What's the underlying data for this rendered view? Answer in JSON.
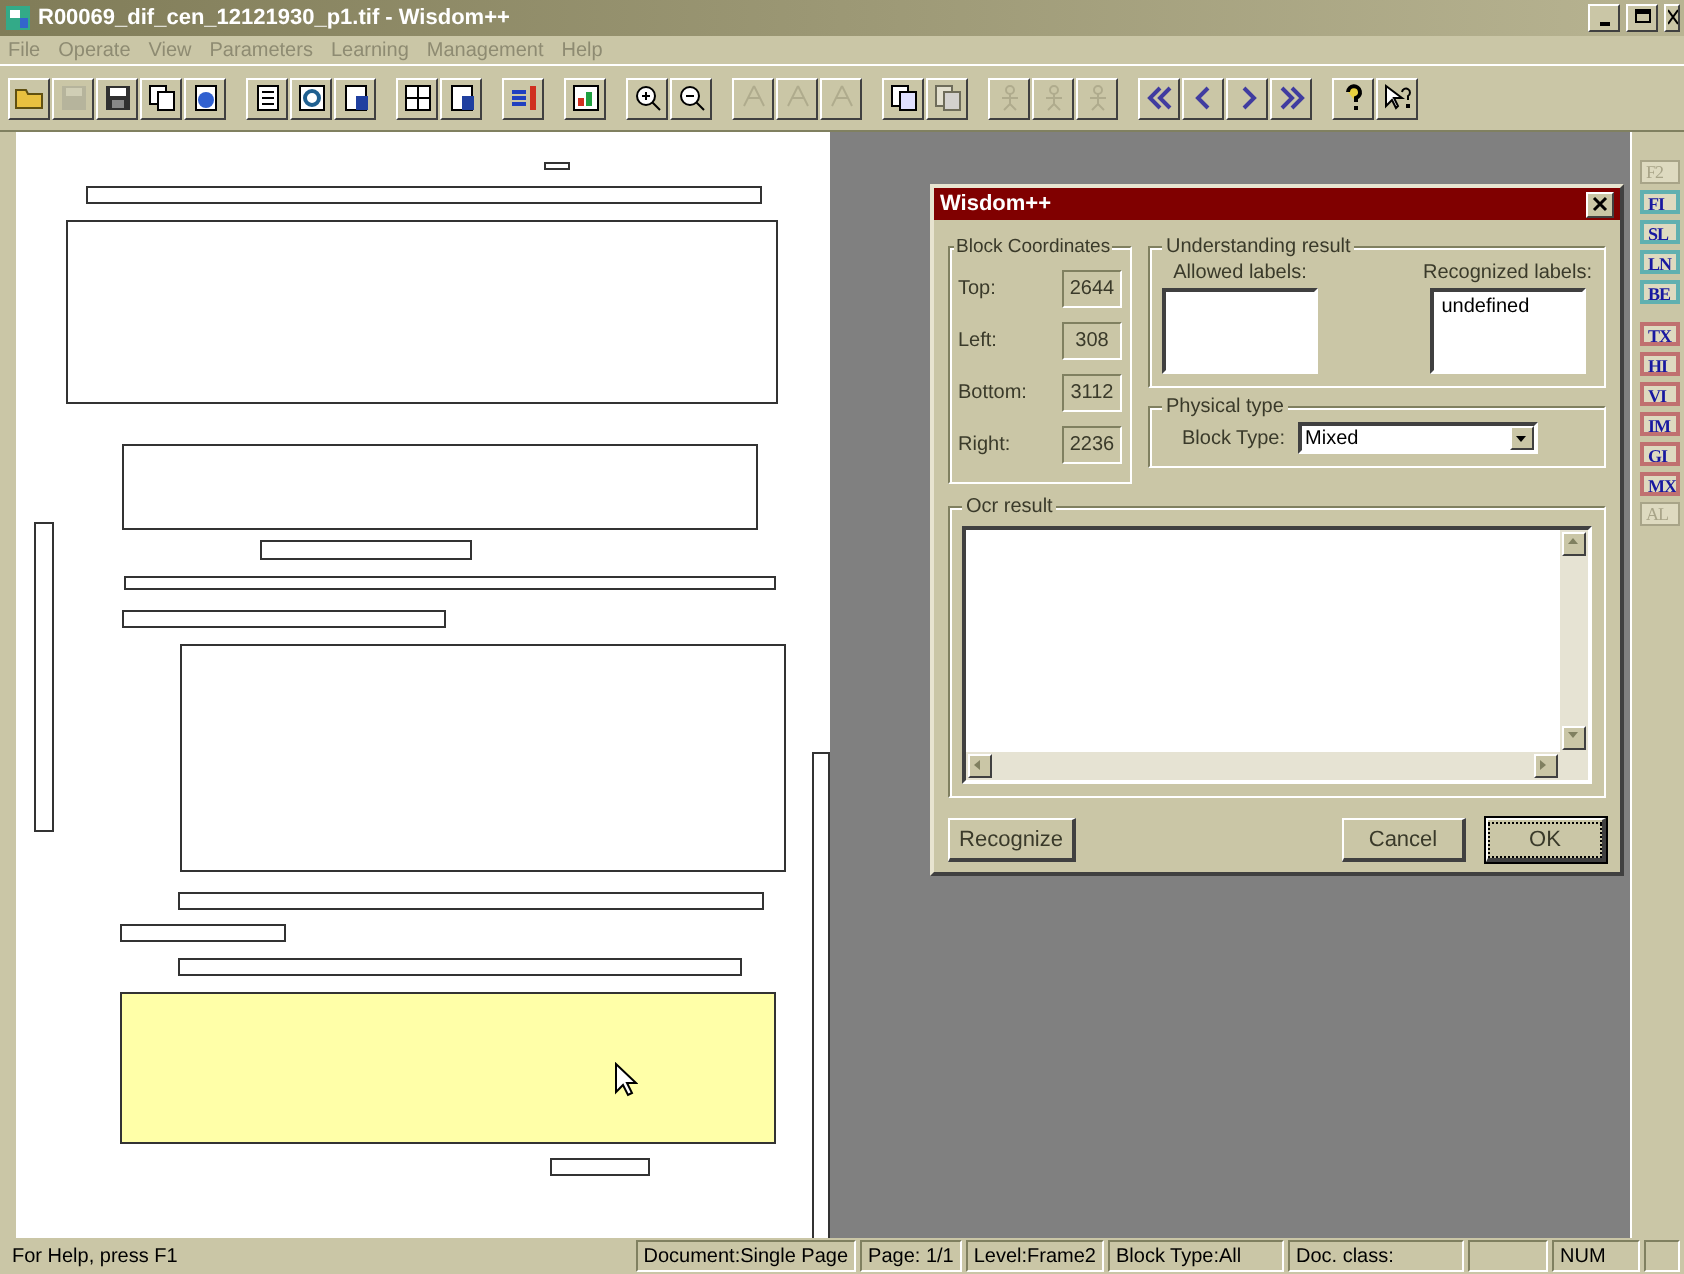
{
  "window": {
    "title": "R00069_dif_cen_12121930_p1.tif - Wisdom++"
  },
  "menu": [
    {
      "label": "File",
      "disabled": true
    },
    {
      "label": "Operate",
      "disabled": true
    },
    {
      "label": "View",
      "disabled": true
    },
    {
      "label": "Parameters",
      "disabled": true
    },
    {
      "label": "Learning",
      "disabled": true
    },
    {
      "label": "Management",
      "disabled": true
    },
    {
      "label": "Help",
      "disabled": true
    }
  ],
  "toolbar": [
    [
      {
        "kind": "open",
        "disabled": false
      },
      {
        "kind": "save",
        "disabled": true
      },
      {
        "kind": "disk",
        "disabled": false
      },
      {
        "kind": "copy",
        "disabled": false
      },
      {
        "kind": "globe",
        "disabled": false
      }
    ],
    [
      {
        "kind": "doc",
        "disabled": false
      },
      {
        "kind": "refresh",
        "disabled": false
      },
      {
        "kind": "docq",
        "disabled": false
      }
    ],
    [
      {
        "kind": "grid",
        "disabled": false
      },
      {
        "kind": "docq",
        "disabled": false
      }
    ],
    [
      {
        "kind": "pencil",
        "disabled": false
      }
    ],
    [
      {
        "kind": "chart",
        "disabled": false
      }
    ],
    [
      {
        "kind": "zoomin",
        "disabled": false
      },
      {
        "kind": "zoomout",
        "disabled": false
      }
    ],
    [
      {
        "kind": "tree",
        "disabled": true
      },
      {
        "kind": "tree",
        "disabled": true
      },
      {
        "kind": "tree",
        "disabled": true
      }
    ],
    [
      {
        "kind": "pages",
        "disabled": false
      },
      {
        "kind": "pages",
        "disabled": true
      }
    ],
    [
      {
        "kind": "figure",
        "disabled": true
      },
      {
        "kind": "figure",
        "disabled": true
      },
      {
        "kind": "figure",
        "disabled": true
      }
    ],
    [
      {
        "kind": "first",
        "disabled": false
      },
      {
        "kind": "prev",
        "disabled": false
      },
      {
        "kind": "next",
        "disabled": false
      },
      {
        "kind": "last",
        "disabled": false
      }
    ],
    [
      {
        "kind": "help",
        "disabled": false
      },
      {
        "kind": "contexthelp",
        "disabled": false
      }
    ]
  ],
  "document": {
    "blocks": [
      {
        "kind": "rect",
        "selected": false
      },
      {
        "kind": "rect",
        "selected": false
      },
      {
        "kind": "rect",
        "selected": false
      },
      {
        "kind": "rect",
        "selected": false
      },
      {
        "kind": "rect",
        "selected": false
      },
      {
        "kind": "rect",
        "selected": false
      },
      {
        "kind": "rect",
        "selected": false
      },
      {
        "kind": "rect",
        "selected": false
      },
      {
        "kind": "rect",
        "selected": false
      },
      {
        "kind": "rect",
        "selected": false
      },
      {
        "kind": "rect",
        "selected": false
      },
      {
        "kind": "rect",
        "selected": true
      },
      {
        "kind": "rect",
        "selected": false
      },
      {
        "kind": "rect",
        "selected": false
      },
      {
        "kind": "rect",
        "selected": false
      }
    ]
  },
  "palette": [
    {
      "label": "F2",
      "kind": "plain",
      "disabled": true
    },
    {
      "label": "FI",
      "kind": "frame",
      "disabled": false
    },
    {
      "label": "SL",
      "kind": "frame",
      "disabled": false
    },
    {
      "label": "LN",
      "kind": "frame",
      "disabled": false
    },
    {
      "label": "BE",
      "kind": "frame",
      "disabled": false
    },
    {
      "label": "TX",
      "kind": "block",
      "disabled": false
    },
    {
      "label": "HI",
      "kind": "block",
      "disabled": false
    },
    {
      "label": "VI",
      "kind": "block",
      "disabled": false
    },
    {
      "label": "IM",
      "kind": "block",
      "disabled": false
    },
    {
      "label": "GI",
      "kind": "block",
      "disabled": false
    },
    {
      "label": "MX",
      "kind": "block",
      "disabled": false
    },
    {
      "label": "AL",
      "kind": "plain",
      "disabled": true
    }
  ],
  "dialog": {
    "title": "Wisdom++",
    "block_coordinates": {
      "title": "Block Coordinates",
      "fields": [
        {
          "label": "Top:",
          "value": "2644"
        },
        {
          "label": "Left:",
          "value": "308"
        },
        {
          "label": "Bottom:",
          "value": "3112"
        },
        {
          "label": "Right:",
          "value": "2236"
        }
      ]
    },
    "understanding_result": {
      "title": "Understanding result",
      "allowed_labels": {
        "label": "Allowed labels:"
      },
      "recognized_labels": {
        "label": "Recognized labels:",
        "items": [
          "undefined"
        ]
      }
    },
    "physical_type": {
      "title": "Physical type",
      "block_type": {
        "label": "Block Type:",
        "value": "Mixed"
      }
    },
    "ocr_result": {
      "title": "Ocr result"
    },
    "buttons": [
      {
        "label": "Recognize",
        "default": false
      },
      {
        "label": "Cancel",
        "default": false
      },
      {
        "label": "OK",
        "default": true
      }
    ]
  },
  "status_bar": [
    {
      "text": "For Help, press F1"
    },
    {
      "text": "Document:Single Page"
    },
    {
      "text": "Page: 1/1"
    },
    {
      "text": "Level:Frame2"
    },
    {
      "text": "Block Type:All"
    },
    {
      "text": "Doc. class:"
    },
    {
      "text": "NUM"
    }
  ]
}
